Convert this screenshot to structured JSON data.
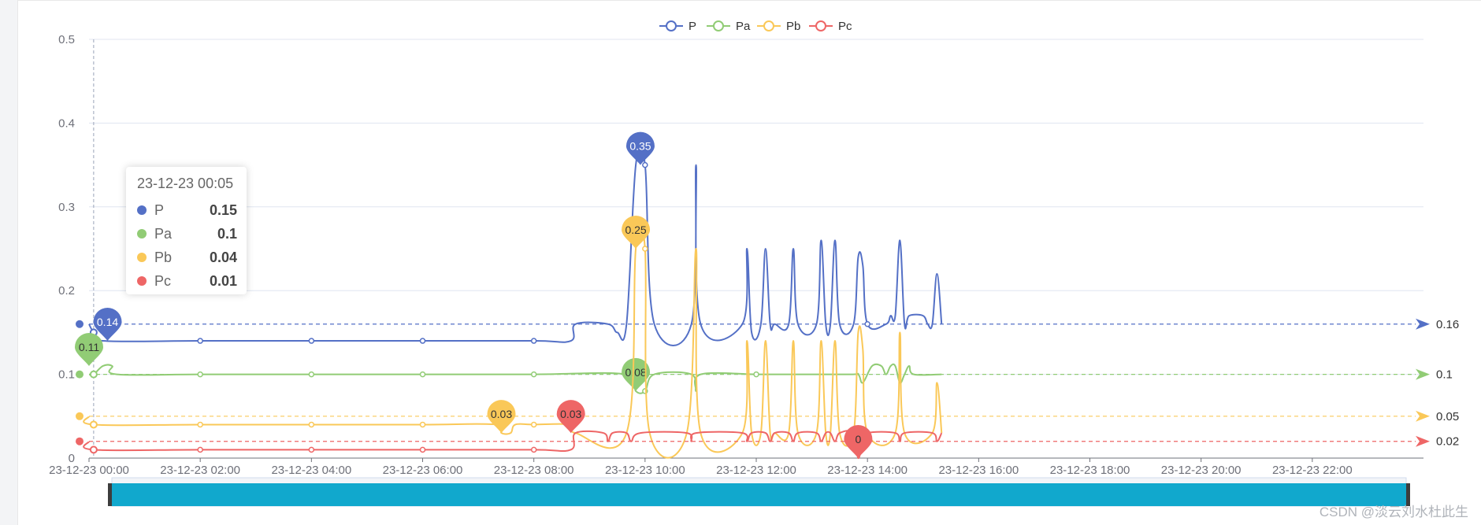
{
  "chart_data": {
    "type": "line",
    "legend": {
      "position": "top-center",
      "items": [
        "P",
        "Pa",
        "Pb",
        "Pc"
      ]
    },
    "y_axis": {
      "min": 0,
      "max": 0.5,
      "ticks": [
        "0",
        "0.1",
        "0.2",
        "0.3",
        "0.4",
        "0.5"
      ]
    },
    "x_axis": {
      "start": "23-12-23 00:00",
      "end": "23-12-24 00:00",
      "tick_labels": [
        "23-12-23 00:00",
        "23-12-23 02:00",
        "23-12-23 04:00",
        "23-12-23 06:00",
        "23-12-23 08:00",
        "23-12-23 10:00",
        "23-12-23 12:00",
        "23-12-23 14:00",
        "23-12-23 16:00",
        "23-12-23 18:00",
        "23-12-23 20:00",
        "23-12-23 22:00"
      ]
    },
    "grid": true,
    "series": [
      {
        "name": "P",
        "color": "#5470c6",
        "average": {
          "value": 0.16,
          "label": "0.16"
        },
        "max_pin": {
          "time": "09:55",
          "value": 0.35,
          "label": "0.35"
        },
        "min_pin": {
          "time": "00:20",
          "value": 0.14,
          "label": "0.14"
        },
        "points": [
          [
            "00:00",
            0.16
          ],
          [
            "00:05",
            0.15
          ],
          [
            "00:15",
            0.14
          ],
          [
            "02:00",
            0.14
          ],
          [
            "04:00",
            0.14
          ],
          [
            "06:00",
            0.14
          ],
          [
            "08:00",
            0.14
          ],
          [
            "08:40",
            0.14
          ],
          [
            "08:45",
            0.16
          ],
          [
            "09:20",
            0.16
          ],
          [
            "09:30",
            0.15
          ],
          [
            "09:40",
            0.16
          ],
          [
            "09:50",
            0.35
          ],
          [
            "10:00",
            0.35
          ],
          [
            "10:10",
            0.16
          ],
          [
            "10:50",
            0.16
          ],
          [
            "10:55",
            0.35
          ],
          [
            "11:00",
            0.16
          ],
          [
            "11:45",
            0.16
          ],
          [
            "11:50",
            0.25
          ],
          [
            "11:55",
            0.15
          ],
          [
            "12:05",
            0.16
          ],
          [
            "12:10",
            0.25
          ],
          [
            "12:15",
            0.16
          ],
          [
            "12:20",
            0.16
          ],
          [
            "12:35",
            0.16
          ],
          [
            "12:40",
            0.25
          ],
          [
            "12:45",
            0.16
          ],
          [
            "13:05",
            0.16
          ],
          [
            "13:10",
            0.26
          ],
          [
            "13:15",
            0.16
          ],
          [
            "13:20",
            0.16
          ],
          [
            "13:25",
            0.26
          ],
          [
            "13:30",
            0.16
          ],
          [
            "13:45",
            0.16
          ],
          [
            "13:50",
            0.24
          ],
          [
            "13:55",
            0.23
          ],
          [
            "14:00",
            0.16
          ],
          [
            "14:20",
            0.16
          ],
          [
            "14:25",
            0.17
          ],
          [
            "14:30",
            0.17
          ],
          [
            "14:35",
            0.26
          ],
          [
            "14:40",
            0.16
          ],
          [
            "14:45",
            0.17
          ],
          [
            "15:00",
            0.17
          ],
          [
            "15:05",
            0.16
          ],
          [
            "15:10",
            0.16
          ],
          [
            "15:15",
            0.22
          ],
          [
            "15:20",
            0.16
          ]
        ]
      },
      {
        "name": "Pa",
        "color": "#91cc75",
        "average": {
          "value": 0.1,
          "label": "0.1"
        },
        "max_pin": {
          "time": "00:00",
          "value": 0.11,
          "label": "0.11"
        },
        "min_pin": {
          "time": "09:50",
          "value": 0.08,
          "label": "0.08"
        },
        "points": [
          [
            "00:00",
            0.1
          ],
          [
            "00:05",
            0.1
          ],
          [
            "00:15",
            0.11
          ],
          [
            "00:25",
            0.11
          ],
          [
            "00:30",
            0.1
          ],
          [
            "02:00",
            0.1
          ],
          [
            "04:00",
            0.1
          ],
          [
            "06:00",
            0.1
          ],
          [
            "08:00",
            0.1
          ],
          [
            "09:40",
            0.1
          ],
          [
            "09:50",
            0.08
          ],
          [
            "10:00",
            0.08
          ],
          [
            "10:10",
            0.1
          ],
          [
            "10:50",
            0.1
          ],
          [
            "10:55",
            0.08
          ],
          [
            "11:00",
            0.1
          ],
          [
            "12:00",
            0.1
          ],
          [
            "12:20",
            0.1
          ],
          [
            "13:40",
            0.1
          ],
          [
            "13:50",
            0.1
          ],
          [
            "13:55",
            0.09
          ],
          [
            "14:05",
            0.11
          ],
          [
            "14:15",
            0.11
          ],
          [
            "14:20",
            0.1
          ],
          [
            "14:25",
            0.11
          ],
          [
            "14:30",
            0.11
          ],
          [
            "14:35",
            0.09
          ],
          [
            "14:40",
            0.1
          ],
          [
            "14:45",
            0.11
          ],
          [
            "14:50",
            0.1
          ],
          [
            "15:20",
            0.1
          ]
        ]
      },
      {
        "name": "Pb",
        "color": "#fac858",
        "average": {
          "value": 0.05,
          "label": "0.05"
        },
        "max_pin": {
          "time": "09:50",
          "value": 0.25,
          "label": "0.25"
        },
        "min_pin": {
          "time": "07:25",
          "value": 0.03,
          "label": "0.03"
        },
        "points": [
          [
            "00:00",
            0.05
          ],
          [
            "00:05",
            0.04
          ],
          [
            "02:00",
            0.04
          ],
          [
            "04:00",
            0.04
          ],
          [
            "06:00",
            0.04
          ],
          [
            "07:20",
            0.04
          ],
          [
            "07:25",
            0.03
          ],
          [
            "07:35",
            0.03
          ],
          [
            "07:40",
            0.04
          ],
          [
            "08:00",
            0.04
          ],
          [
            "08:40",
            0.04
          ],
          [
            "08:45",
            0.03
          ],
          [
            "09:40",
            0.03
          ],
          [
            "09:50",
            0.25
          ],
          [
            "10:00",
            0.25
          ],
          [
            "10:05",
            0.03
          ],
          [
            "10:45",
            0.03
          ],
          [
            "10:55",
            0.25
          ],
          [
            "11:00",
            0.03
          ],
          [
            "11:45",
            0.03
          ],
          [
            "11:50",
            0.14
          ],
          [
            "11:55",
            0.03
          ],
          [
            "12:05",
            0.03
          ],
          [
            "12:10",
            0.14
          ],
          [
            "12:15",
            0.03
          ],
          [
            "12:20",
            0.03
          ],
          [
            "12:35",
            0.03
          ],
          [
            "12:40",
            0.14
          ],
          [
            "12:45",
            0.03
          ],
          [
            "13:05",
            0.03
          ],
          [
            "13:10",
            0.14
          ],
          [
            "13:15",
            0.03
          ],
          [
            "13:20",
            0.03
          ],
          [
            "13:25",
            0.14
          ],
          [
            "13:30",
            0.03
          ],
          [
            "13:45",
            0.03
          ],
          [
            "13:50",
            0.15
          ],
          [
            "13:55",
            0.13
          ],
          [
            "14:00",
            0.03
          ],
          [
            "14:30",
            0.03
          ],
          [
            "14:35",
            0.15
          ],
          [
            "14:40",
            0.03
          ],
          [
            "15:10",
            0.03
          ],
          [
            "15:15",
            0.09
          ],
          [
            "15:20",
            0.03
          ]
        ]
      },
      {
        "name": "Pc",
        "color": "#ee6666",
        "average": {
          "value": 0.02,
          "label": "0.02"
        },
        "max_pin": {
          "time": "08:40",
          "value": 0.03,
          "label": "0.03"
        },
        "min_pin": {
          "time": "13:50",
          "value": 0,
          "label": "0"
        },
        "points": [
          [
            "00:00",
            0.02
          ],
          [
            "00:05",
            0.01
          ],
          [
            "02:00",
            0.01
          ],
          [
            "04:00",
            0.01
          ],
          [
            "06:00",
            0.01
          ],
          [
            "08:00",
            0.01
          ],
          [
            "08:40",
            0.01
          ],
          [
            "08:45",
            0.03
          ],
          [
            "09:15",
            0.03
          ],
          [
            "09:20",
            0.02
          ],
          [
            "09:25",
            0.03
          ],
          [
            "09:40",
            0.03
          ],
          [
            "09:45",
            0.02
          ],
          [
            "09:55",
            0.03
          ],
          [
            "10:45",
            0.03
          ],
          [
            "10:50",
            0.02
          ],
          [
            "10:55",
            0.03
          ],
          [
            "11:45",
            0.03
          ],
          [
            "11:50",
            0.02
          ],
          [
            "11:55",
            0.03
          ],
          [
            "12:10",
            0.03
          ],
          [
            "12:15",
            0.02
          ],
          [
            "12:20",
            0.03
          ],
          [
            "12:35",
            0.03
          ],
          [
            "12:40",
            0.02
          ],
          [
            "12:45",
            0.03
          ],
          [
            "13:05",
            0.03
          ],
          [
            "13:10",
            0.02
          ],
          [
            "13:15",
            0.03
          ],
          [
            "13:20",
            0.03
          ],
          [
            "13:25",
            0.02
          ],
          [
            "13:30",
            0.03
          ],
          [
            "13:45",
            0.03
          ],
          [
            "13:50",
            0
          ],
          [
            "13:55",
            0.02
          ],
          [
            "14:00",
            0.03
          ],
          [
            "14:30",
            0.03
          ],
          [
            "14:35",
            0.02
          ],
          [
            "14:40",
            0.03
          ],
          [
            "15:10",
            0.03
          ],
          [
            "15:15",
            0.02
          ],
          [
            "15:20",
            0.03
          ]
        ]
      }
    ],
    "tooltip": {
      "title": "23-12-23 00:05",
      "rows": [
        {
          "name": "P",
          "value": "0.15",
          "color": "#5470c6"
        },
        {
          "name": "Pa",
          "value": "0.1",
          "color": "#91cc75"
        },
        {
          "name": "Pb",
          "value": "0.04",
          "color": "#fac858"
        },
        {
          "name": "Pc",
          "value": "0.01",
          "color": "#ee6666"
        }
      ]
    },
    "crosshair_time": "00:05",
    "data_zoom": {
      "start": 0,
      "end": 1,
      "fill_color": "#11a8cd"
    }
  },
  "watermark": "CSDN @淡云刘水杜此生"
}
